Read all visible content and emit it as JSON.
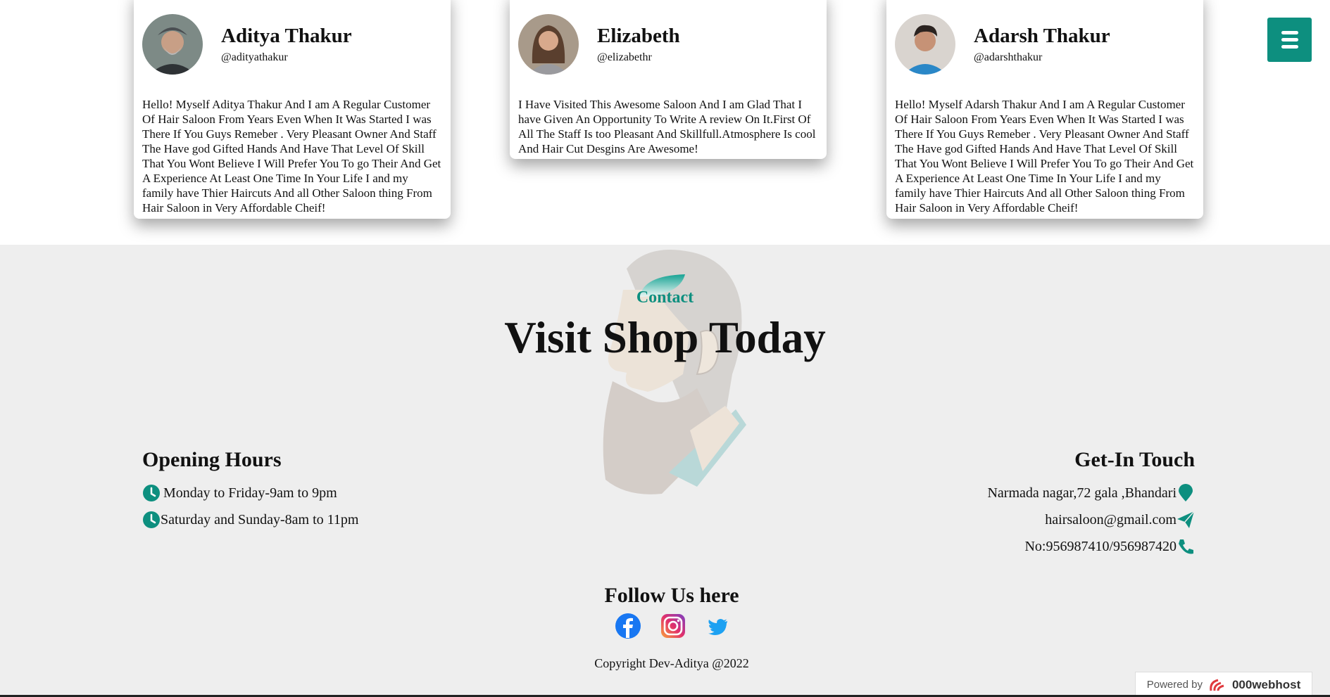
{
  "reviews": [
    {
      "name": "Aditya Thakur",
      "handle": "@adityathakur",
      "text": "Hello! Myself Aditya Thakur And I am A Regular Customer Of Hair Saloon From Years Even When It Was Started I was There If You Guys Remeber . Very Pleasant Owner And Staff The Have god Gifted Hands And Have That Level Of Skill That You Wont Believe I Will Prefer You To go Their And Get A Experience At Least One Time In Your Life I and my family have Thier Haircuts And all Other Saloon thing From Hair Saloon in Very Affordable Cheif!"
    },
    {
      "name": "Elizabeth",
      "handle": "@elizabethr",
      "text": "I Have Visited This Awesome Saloon And I am Glad That I have Given An Opportunity To Write A review On It.First Of All The Staff Is too Pleasant And Skillfull.Atmosphere Is cool And Hair Cut Desgins Are Awesome!"
    },
    {
      "name": "Adarsh Thakur",
      "handle": "@adarshthakur",
      "text": "Hello! Myself Adarsh Thakur And I am A Regular Customer Of Hair Saloon From Years Even When It Was Started I was There If You Guys Remeber . Very Pleasant Owner And Staff The Have god Gifted Hands And Have That Level Of Skill That You Wont Believe I Will Prefer You To go Their And Get A Experience At Least One Time In Your Life I and my family have Thier Haircuts And all Other Saloon thing From Hair Saloon in Very Affordable Cheif!"
    }
  ],
  "contact": {
    "eyebrow": "Contact",
    "headline": "Visit Shop Today",
    "opening": {
      "title": "Opening Hours",
      "rows": [
        "Monday to Friday-9am to 9pm",
        "Saturday and Sunday-8am to 11pm"
      ]
    },
    "touch": {
      "title": "Get-In Touch",
      "address": "Narmada nagar,72 gala ,Bhandari",
      "email": "hairsaloon@gmail.com",
      "phone": "No:956987410/956987420"
    },
    "follow": "Follow Us here",
    "copyright": "Copyright Dev-Aditya @2022"
  },
  "powered": {
    "label": "Powered by",
    "brand": "000webhost"
  },
  "colors": {
    "accent": "#0d8f7f",
    "section_bg": "#eeeeee"
  },
  "icons": [
    "clock-icon",
    "location-pin-icon",
    "paper-plane-icon",
    "phone-icon",
    "facebook-icon",
    "instagram-icon",
    "twitter-icon",
    "menu-icon"
  ]
}
